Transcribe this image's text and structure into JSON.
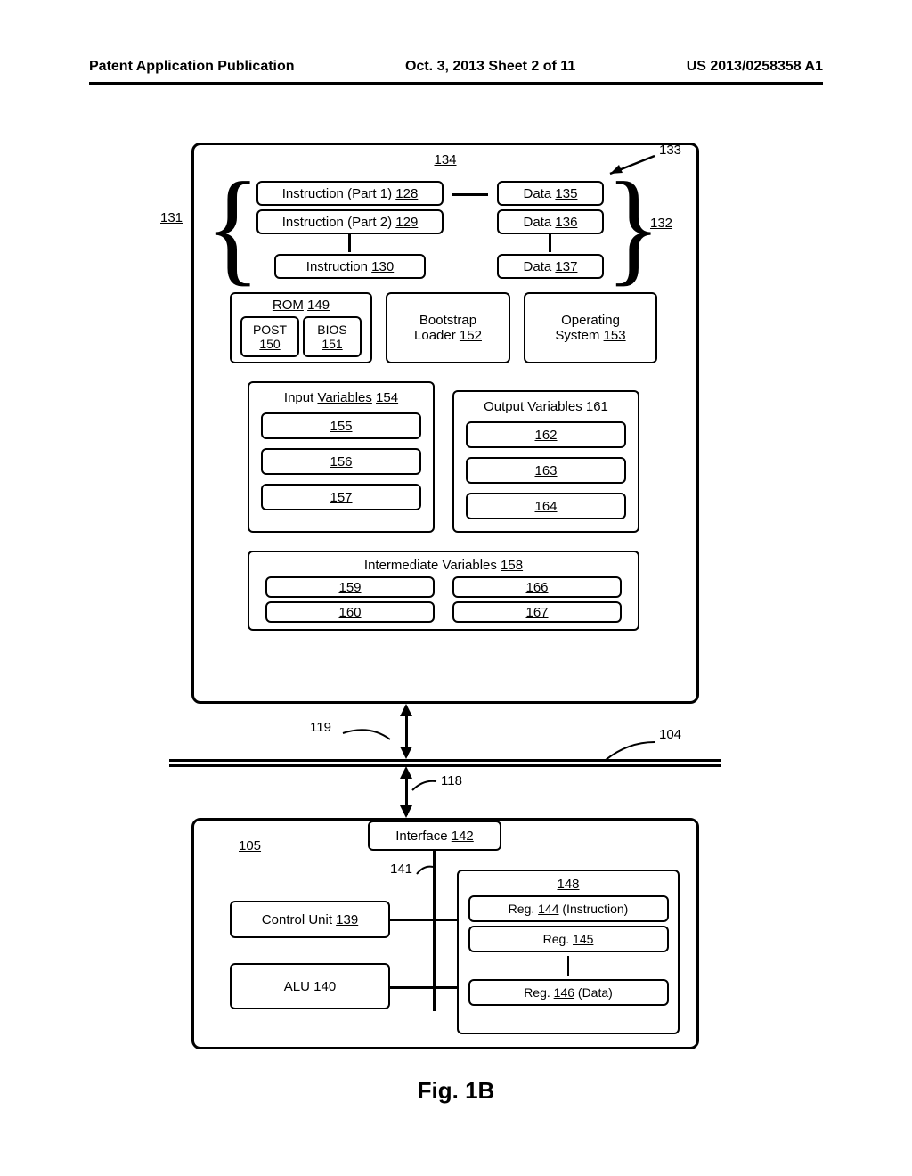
{
  "header": {
    "left": "Patent Application Publication",
    "center": "Oct. 3, 2013  Sheet 2 of 11",
    "right": "US 2013/0258358 A1"
  },
  "mem": {
    "ref134": "134",
    "ref133": "133",
    "ref131": "131",
    "ref132": "132",
    "instr1": {
      "text": "Instruction (Part 1)",
      "ref": "128"
    },
    "instr2": {
      "text": "Instruction (Part 2)",
      "ref": "129"
    },
    "instr3": {
      "text": "Instruction",
      "ref": "130"
    },
    "data1": {
      "text": "Data",
      "ref": "135"
    },
    "data2": {
      "text": "Data",
      "ref": "136"
    },
    "data3": {
      "text": "Data",
      "ref": "137"
    },
    "rom": {
      "text": "ROM",
      "ref": "149"
    },
    "post": {
      "text": "POST",
      "ref": "150"
    },
    "bios": {
      "text": "BIOS",
      "ref": "151"
    },
    "bootstrap": {
      "line1": "Bootstrap",
      "line2a": "Loader",
      "ref": "152"
    },
    "os": {
      "line1": "Operating",
      "line2a": "System",
      "ref": "153"
    },
    "inputvars": {
      "text": "Input Variables",
      "ref": "154",
      "r1": "155",
      "r2": "156",
      "r3": "157"
    },
    "outputvars": {
      "text": "Output Variables",
      "ref": "161",
      "r1": "162",
      "r2": "163",
      "r3": "164"
    },
    "intermed": {
      "text": "Intermediate Variables",
      "ref": "158",
      "a1": "159",
      "a2": "160",
      "b1": "166",
      "b2": "167"
    }
  },
  "misc": {
    "ref119": "119",
    "ref104": "104",
    "ref118": "118",
    "ref141": "141"
  },
  "cpu": {
    "ref105": "105",
    "interface": {
      "text": "Interface",
      "ref": "142"
    },
    "control": {
      "text": "Control Unit",
      "ref": "139"
    },
    "alu": {
      "text": "ALU",
      "ref": "140"
    },
    "reggroup": "148",
    "reg1": {
      "text": "Reg.",
      "ref": "144",
      "suffix": "(Instruction)"
    },
    "reg2": {
      "text": "Reg.",
      "ref": "145"
    },
    "reg3": {
      "text": "Reg.",
      "ref": "146",
      "suffix": "(Data)"
    }
  },
  "caption": "Fig. 1B"
}
